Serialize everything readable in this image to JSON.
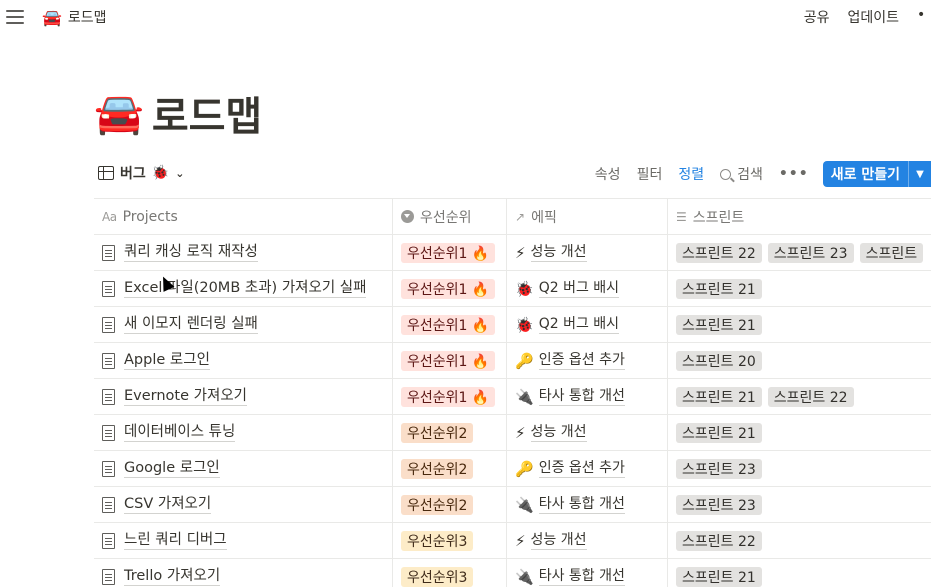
{
  "topbar": {
    "page_emoji": "🚘",
    "page_name": "로드맵",
    "share": "공유",
    "updates": "업데이트",
    "more": "•"
  },
  "page": {
    "emoji": "🚘",
    "title": "로드맵"
  },
  "view": {
    "name": "버그",
    "emoji": "🐞",
    "actions": {
      "properties": "속성",
      "filter": "필터",
      "sort": "정렬",
      "search": "검색",
      "more": "•••",
      "new": "새로 만들기"
    },
    "accent_color": "#2383e2"
  },
  "table": {
    "columns": [
      {
        "icon": "Aa",
        "label": "Projects"
      },
      {
        "icon": "select-icon",
        "label": "우선순위"
      },
      {
        "icon": "↗",
        "label": "에픽"
      },
      {
        "icon": "☰",
        "label": "스프린트"
      }
    ],
    "rows": [
      {
        "name": "쿼리 캐싱 로직 재작성",
        "priority": "우선순위1 🔥",
        "level": "p1",
        "epic_emoji": "⚡",
        "epic": "성능 개선",
        "sprints": [
          "스프린트 22",
          "스프린트 23",
          "스프린트"
        ]
      },
      {
        "name": "Excel 파일(20MB 초과) 가져오기 실패",
        "priority": "우선순위1 🔥",
        "level": "p1",
        "epic_emoji": "🐞",
        "epic": "Q2 버그 배시",
        "sprints": [
          "스프린트 21"
        ]
      },
      {
        "name": "새 이모지 렌더링 실패",
        "priority": "우선순위1 🔥",
        "level": "p1",
        "epic_emoji": "🐞",
        "epic": "Q2 버그 배시",
        "sprints": [
          "스프린트 21"
        ]
      },
      {
        "name": "Apple 로그인",
        "priority": "우선순위1 🔥",
        "level": "p1",
        "epic_emoji": "🔑",
        "epic": "인증 옵션 추가",
        "sprints": [
          "스프린트 20"
        ]
      },
      {
        "name": "Evernote 가져오기",
        "priority": "우선순위1 🔥",
        "level": "p1",
        "epic_emoji": "🔌",
        "epic": "타사 통합 개선",
        "sprints": [
          "스프린트 21",
          "스프린트 22"
        ]
      },
      {
        "name": "데이터베이스 튜닝",
        "priority": "우선순위2",
        "level": "p2",
        "epic_emoji": "⚡",
        "epic": "성능 개선",
        "sprints": [
          "스프린트 21"
        ]
      },
      {
        "name": "Google 로그인",
        "priority": "우선순위2",
        "level": "p2",
        "epic_emoji": "🔑",
        "epic": "인증 옵션 추가",
        "sprints": [
          "스프린트 23"
        ]
      },
      {
        "name": "CSV 가져오기",
        "priority": "우선순위2",
        "level": "p2",
        "epic_emoji": "🔌",
        "epic": "타사 통합 개선",
        "sprints": [
          "스프린트 23"
        ]
      },
      {
        "name": "느린 쿼리 디버그",
        "priority": "우선순위3",
        "level": "p3",
        "epic_emoji": "⚡",
        "epic": "성능 개선",
        "sprints": [
          "스프린트 22"
        ]
      },
      {
        "name": "Trello 가져오기",
        "priority": "우선순위3",
        "level": "p3",
        "epic_emoji": "🔌",
        "epic": "타사 통합 개선",
        "sprints": [
          "스프린트 21"
        ]
      }
    ]
  }
}
